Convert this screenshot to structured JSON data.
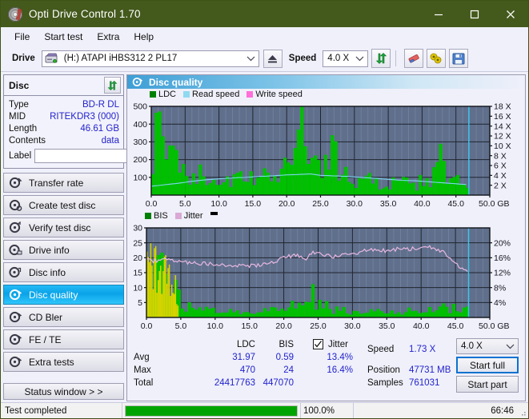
{
  "window": {
    "title": "Opti Drive Control 1.70",
    "icon": "disc-icon",
    "minimize_label": "–",
    "maximize_label": "□",
    "close_label": "✕"
  },
  "menu": {
    "items": [
      {
        "label": "File",
        "name": "menu-file"
      },
      {
        "label": "Start test",
        "name": "menu-start-test"
      },
      {
        "label": "Extra",
        "name": "menu-extra"
      },
      {
        "label": "Help",
        "name": "menu-help"
      }
    ]
  },
  "toolbar": {
    "drive_label": "Drive",
    "drive_value": "(H:)   ATAPI iHBS312   2 PL17",
    "eject_icon": "eject-icon",
    "speed_label": "Speed",
    "speed_value": "4.0 X",
    "refresh_icon": "refresh-icon",
    "eraser_icon": "eraser-icon",
    "bitsetting_icon": "bitsetting-icon",
    "save_icon": "save-icon"
  },
  "sidebar": {
    "disc": {
      "title": "Disc",
      "refresh_icon": "refresh-disc-icon",
      "rows": [
        {
          "key": "Type",
          "value": "BD-R DL"
        },
        {
          "key": "MID",
          "value": "RITEKDR3 (000)"
        },
        {
          "key": "Length",
          "value": "46.61 GB"
        },
        {
          "key": "Contents",
          "value": "data"
        }
      ],
      "label_key": "Label",
      "label_value": "",
      "label_placeholder": "",
      "label_button_icon": "disc-label-icon"
    },
    "nav": [
      {
        "label": "Transfer rate",
        "icon": "transfer-rate-icon",
        "active": false
      },
      {
        "label": "Create test disc",
        "icon": "create-test-disc-icon",
        "active": false
      },
      {
        "label": "Verify test disc",
        "icon": "verify-test-disc-icon",
        "active": false
      },
      {
        "label": "Drive info",
        "icon": "drive-info-icon",
        "active": false
      },
      {
        "label": "Disc info",
        "icon": "disc-info-icon",
        "active": false
      },
      {
        "label": "Disc quality",
        "icon": "disc-quality-icon",
        "active": true
      },
      {
        "label": "CD Bler",
        "icon": "cd-bler-icon",
        "active": false
      },
      {
        "label": "FE / TE",
        "icon": "fe-te-icon",
        "active": false
      },
      {
        "label": "Extra tests",
        "icon": "extra-tests-icon",
        "active": false
      }
    ],
    "status_window_label": "Status window > >"
  },
  "pane": {
    "title": "Disc quality",
    "icon": "disc-quality-icon"
  },
  "stats": {
    "col_ldc": "LDC",
    "col_bis": "BIS",
    "jitter_label": "Jitter",
    "jitter_checked": true,
    "rows": [
      {
        "label": "Avg",
        "ldc": "31.97",
        "bis": "0.59",
        "jitter": "13.4%"
      },
      {
        "label": "Max",
        "ldc": "470",
        "bis": "24",
        "jitter": "16.4%"
      },
      {
        "label": "Total",
        "ldc": "24417763",
        "bis": "447070",
        "jitter": ""
      }
    ],
    "speed_key": "Speed",
    "speed_value": "1.73 X",
    "position_key": "Position",
    "position_value": "47731 MB",
    "samples_key": "Samples",
    "samples_value": "761031",
    "speed_select_value": "4.0 X",
    "start_full_label": "Start full",
    "start_part_label": "Start part"
  },
  "statusbar": {
    "message": "Test completed",
    "percent_label": "100.0%",
    "percent_value": 100,
    "time": "66:46"
  },
  "colors": {
    "titlebar": "#44591c",
    "accent_blue": "#2222cc",
    "plot_bg": "#5f6f8c",
    "ldc_green": "#00c000",
    "bis_green": "#00c000",
    "jitter_pink": "#e8b7e0",
    "read_speed": "#7fd8f5",
    "write_speed": "#ff6fd8",
    "progress_green": "#00a400",
    "active_nav": "#0aa3e8"
  },
  "chart_data": [
    {
      "type": "area",
      "id": "top-chart",
      "title": "",
      "xlabel": "GB",
      "ylabel": "",
      "xlim": [
        0,
        50
      ],
      "xticks": [
        0.0,
        5.0,
        10.0,
        15.0,
        20.0,
        25.0,
        30.0,
        35.0,
        40.0,
        45.0,
        50.0
      ],
      "xticklabels": [
        "0.0",
        "5.0",
        "10.0",
        "15.0",
        "20.0",
        "25.0",
        "30.0",
        "35.0",
        "40.0",
        "45.0",
        "50.0 GB"
      ],
      "ylim": [
        0,
        500
      ],
      "yticks": [
        100,
        200,
        300,
        400,
        500
      ],
      "yticklabels": [
        "100",
        "200",
        "300",
        "400",
        "500"
      ],
      "y2lim": [
        0,
        18
      ],
      "y2ticks": [
        2,
        4,
        6,
        8,
        10,
        12,
        14,
        16,
        18
      ],
      "y2ticklabels": [
        "2 X",
        "4 X",
        "6 X",
        "8 X",
        "10 X",
        "12 X",
        "14 X",
        "16 X",
        "18 X"
      ],
      "grid": true,
      "legend": [
        "LDC",
        "Read speed",
        "Write speed"
      ],
      "legend_position": "top-left",
      "series": [
        {
          "name": "LDC",
          "color": "#00c000",
          "axis": "left",
          "x": [
            0.0,
            0.3,
            0.6,
            0.9,
            1.2,
            1.5,
            1.8,
            2.1,
            2.4,
            2.7,
            3.0,
            3.4,
            3.8,
            4.2,
            4.6,
            5.0,
            5.5,
            6.0,
            6.5,
            7.0,
            7.5,
            8.0,
            8.5,
            9.0,
            9.5,
            10.0,
            10.6,
            11.2,
            11.8,
            12.4,
            13.0,
            13.6,
            14.2,
            14.8,
            15.4,
            16.0,
            16.6,
            17.2,
            17.8,
            18.4,
            19.0,
            19.6,
            20.2,
            20.8,
            21.4,
            22.0,
            22.6,
            23.2,
            23.6,
            24.0,
            24.5,
            25.0,
            25.6,
            26.2,
            26.8,
            27.4,
            28.0,
            29.0,
            30.0,
            31.0,
            32.0,
            33.0,
            34.0,
            35.0,
            36.0,
            37.0,
            38.0,
            39.0,
            40.0,
            41.0,
            42.0,
            42.3,
            43.0,
            43.4,
            44.0,
            45.0,
            46.0,
            46.8
          ],
          "values": [
            300,
            400,
            380,
            330,
            260,
            240,
            250,
            230,
            215,
            205,
            200,
            185,
            310,
            200,
            175,
            165,
            145,
            130,
            120,
            112,
            105,
            100,
            98,
            130,
            95,
            90,
            88,
            92,
            86,
            100,
            88,
            84,
            90,
            82,
            150,
            86,
            100,
            110,
            130,
            150,
            170,
            200,
            250,
            300,
            330,
            470,
            300,
            250,
            140,
            180,
            250,
            120,
            300,
            280,
            260,
            180,
            120,
            90,
            70,
            160,
            80,
            75,
            70,
            68,
            66,
            65,
            64,
            70,
            72,
            80,
            330,
            300,
            280,
            110,
            90,
            75,
            60,
            40
          ]
        },
        {
          "name": "Read speed",
          "color": "#7fd8f5",
          "axis": "right",
          "x": [
            0.0,
            2.0,
            4.0,
            6.0,
            8.0,
            10.0,
            12.0,
            14.0,
            16.0,
            18.0,
            20.0,
            22.0,
            23.5,
            24.0,
            25.0,
            27.0,
            29.0,
            31.0,
            33.0,
            35.0,
            37.0,
            39.0,
            41.0,
            43.0,
            45.0,
            46.8
          ],
          "values": [
            1.8,
            2.1,
            2.4,
            2.8,
            3.1,
            3.3,
            3.5,
            3.6,
            3.8,
            3.9,
            4.1,
            4.2,
            4.3,
            4.2,
            4.0,
            3.9,
            3.8,
            3.6,
            3.4,
            3.2,
            3.0,
            2.9,
            2.7,
            2.5,
            2.3,
            2.1
          ]
        },
        {
          "name": "Write speed",
          "color": "#ff6fd8",
          "axis": "right",
          "x": [],
          "values": []
        }
      ],
      "marker_line": {
        "x": 46.9,
        "color": "#35c6f0"
      }
    },
    {
      "type": "area",
      "id": "bottom-chart",
      "title": "",
      "xlabel": "GB",
      "xlim": [
        0,
        50
      ],
      "xticks": [
        0.0,
        5.0,
        10.0,
        15.0,
        20.0,
        25.0,
        30.0,
        35.0,
        40.0,
        45.0,
        50.0
      ],
      "xticklabels": [
        "0.0",
        "5.0",
        "10.0",
        "15.0",
        "20.0",
        "25.0",
        "30.0",
        "35.0",
        "40.0",
        "45.0",
        "50.0 GB"
      ],
      "ylim": [
        0,
        30
      ],
      "yticks": [
        5,
        10,
        15,
        20,
        25,
        30
      ],
      "yticklabels": [
        "5",
        "10",
        "15",
        "20",
        "25",
        "30"
      ],
      "y2lim": [
        0,
        24
      ],
      "y2ticks": [
        4,
        8,
        12,
        16,
        20
      ],
      "y2ticklabels": [
        "4%",
        "8%",
        "12%",
        "16%",
        "20%"
      ],
      "grid": true,
      "legend": [
        "BIS",
        "Jitter"
      ],
      "legend_position": "top-left",
      "series": [
        {
          "name": "BIS",
          "color": "#00c000",
          "axis": "left",
          "x": [
            0.0,
            0.2,
            0.4,
            0.6,
            0.8,
            1.0,
            1.3,
            1.6,
            1.9,
            2.2,
            2.5,
            2.8,
            3.1,
            3.4,
            3.7,
            4.0,
            4.3,
            4.6,
            5.0,
            5.5,
            6.0,
            6.5,
            7.0,
            7.5,
            8.0,
            9.0,
            10.0,
            11.0,
            12.0,
            13.0,
            14.0,
            15.0,
            16.0,
            17.0,
            18.0,
            19.0,
            20.0,
            21.0,
            22.0,
            23.0,
            24.0,
            25.0,
            26.0,
            27.0,
            28.0,
            29.0,
            30.0,
            31.0,
            32.0,
            33.0,
            34.0,
            35.0,
            36.0,
            37.0,
            38.0,
            39.0,
            40.0,
            41.0,
            42.0,
            42.4,
            43.0,
            44.0,
            45.0,
            46.0,
            46.8
          ],
          "values": [
            17,
            24,
            20,
            17,
            16,
            18,
            15,
            16,
            14,
            15,
            16,
            13,
            15,
            14,
            12,
            9,
            8,
            7,
            6,
            5,
            4.5,
            4,
            3.5,
            3.2,
            3,
            2.6,
            2.4,
            2.2,
            2,
            1.8,
            1.8,
            1.7,
            1.8,
            2,
            2.2,
            2.4,
            3,
            4.5,
            5.5,
            5,
            9,
            4,
            3.5,
            3,
            2.6,
            2.4,
            2.2,
            2,
            1.9,
            1.8,
            1.8,
            1.9,
            2,
            2.1,
            2.2,
            2.3,
            2.4,
            2.6,
            4.5,
            2.8,
            3,
            3.4,
            3.2,
            2.6,
            2.2
          ]
        },
        {
          "name": "Jitter",
          "color": "#e8b7e0",
          "axis": "right",
          "x": [
            0.0,
            0.5,
            1.0,
            1.5,
            2.0,
            2.5,
            3.0,
            3.5,
            4.0,
            5.0,
            6.0,
            7.0,
            8.0,
            9.0,
            10.0,
            11.0,
            12.0,
            13.0,
            14.0,
            15.0,
            16.0,
            17.0,
            18.0,
            19.0,
            20.0,
            21.0,
            21.8,
            22.5,
            23.0,
            23.4,
            23.8,
            24.2,
            25.0,
            26.0,
            27.0,
            28.0,
            29.0,
            30.0,
            31.0,
            32.0,
            33.0,
            34.0,
            35.0,
            36.0,
            37.0,
            38.0,
            39.0,
            40.0,
            41.0,
            42.0,
            43.0,
            43.5,
            44.0,
            44.5,
            45.0,
            45.5,
            46.0,
            46.6
          ],
          "values": [
            15.5,
            15.8,
            15.0,
            15.2,
            15.3,
            15.4,
            15.3,
            15.2,
            15.1,
            15.0,
            14.8,
            14.6,
            14.5,
            14.4,
            14.3,
            14.2,
            14.1,
            14.0,
            13.9,
            13.8,
            14.0,
            14.3,
            14.8,
            15.3,
            15.9,
            16.5,
            16.8,
            16.5,
            16.0,
            15.2,
            17.5,
            17.2,
            17.0,
            16.6,
            16.4,
            16.5,
            16.7,
            17.0,
            17.4,
            17.9,
            18.0,
            17.8,
            18.0,
            18.2,
            18.3,
            18.3,
            18.4,
            18.6,
            18.8,
            18.5,
            17.8,
            17.0,
            16.0,
            15.0,
            14.2,
            13.6,
            13.2,
            12.8
          ]
        }
      ],
      "marker_line": {
        "x": 46.9,
        "color": "#35c6f0"
      },
      "legend_extra_marker": true
    }
  ]
}
